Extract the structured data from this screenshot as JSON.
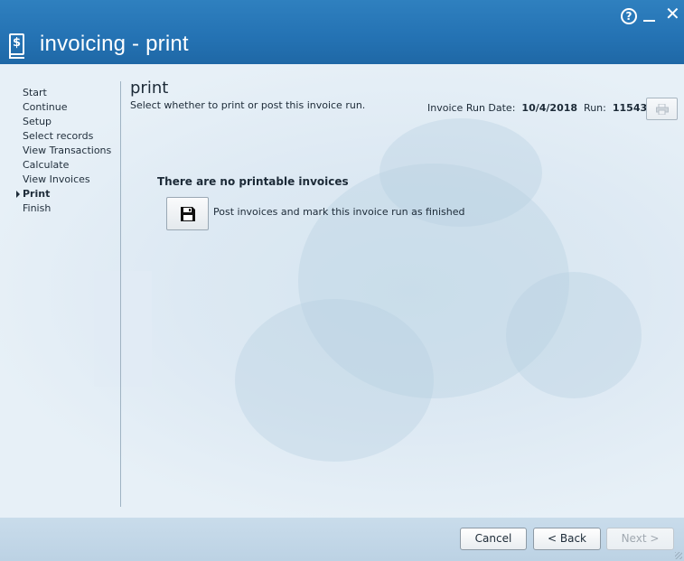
{
  "window": {
    "title": "invoicing - print",
    "help_glyph": "?",
    "close_glyph": "✕"
  },
  "nav": {
    "items": [
      {
        "label": "Start"
      },
      {
        "label": "Continue"
      },
      {
        "label": "Setup"
      },
      {
        "label": "Select records"
      },
      {
        "label": "View Transactions"
      },
      {
        "label": "Calculate"
      },
      {
        "label": "View Invoices"
      },
      {
        "label": "Print",
        "active": true
      },
      {
        "label": "Finish"
      }
    ]
  },
  "page": {
    "title": "print",
    "subtitle": "Select whether to print or post this invoice run.",
    "run_date_label": "Invoice Run Date:",
    "run_date": "10/4/2018",
    "run_label": "Run:",
    "run_number": "11543",
    "print_icon": "printer-icon"
  },
  "body": {
    "no_printable": "There are no printable invoices",
    "post_label": "Post invoices and mark this invoice run as finished",
    "post_icon": "floppy-disk-icon"
  },
  "footer": {
    "cancel": "Cancel",
    "back": "< Back",
    "next": "Next >"
  },
  "colors": {
    "titlebar": "#2472b3",
    "content_bg": "#e6f0f7",
    "footer_bg": "#c9dceb"
  }
}
